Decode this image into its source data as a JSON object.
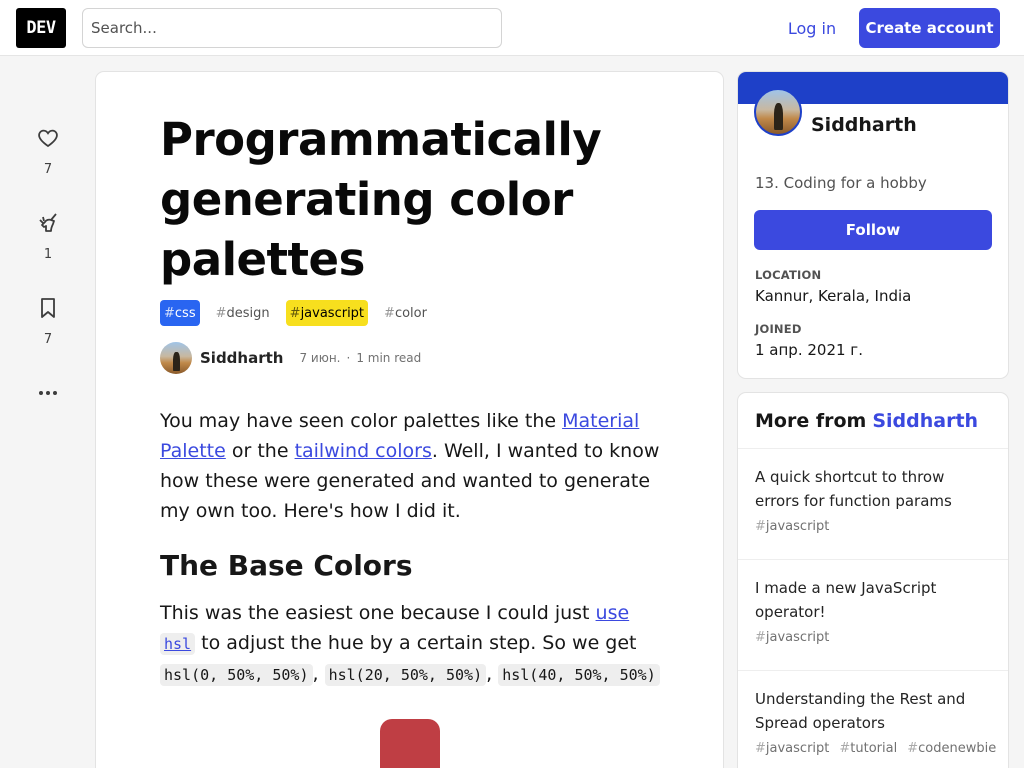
{
  "header": {
    "logo": "DEV",
    "search_placeholder": "Search...",
    "login_label": "Log in",
    "create_label": "Create account"
  },
  "reactions": {
    "likes": "7",
    "unicorns": "1",
    "bookmarks": "7"
  },
  "article": {
    "title": "Programmatically generating color palettes",
    "tags": [
      "css",
      "design",
      "javascript",
      "color"
    ],
    "author": "Siddharth",
    "date": "7 июн.",
    "read_time": "1 min read",
    "p1_a": "You may have seen color palettes like the ",
    "link_material": "Material Palette",
    "p1_b": " or the ",
    "link_tailwind": "tailwind colors",
    "p1_c": ". Well, I wanted to know how these were generated and wanted to generate my own too. Here's how I did it.",
    "h2": "The Base Colors",
    "p2_a": "This was the easiest one because I could just ",
    "link_use": "use",
    "code_hsl": "hsl",
    "p2_b": " to adjust the hue by a certain step. So we get ",
    "code_1": "hsl(0, 50%, 50%)",
    "sep_1": ", ",
    "code_2": "hsl(20, 50%, 50%)",
    "sep_2": ", ",
    "code_3": "hsl(40, 50%, 50%)",
    "swatch_color": "#bf3e44"
  },
  "profile": {
    "name": "Siddharth",
    "bio": "13. Coding for a hobby",
    "follow_label": "Follow",
    "location_label": "LOCATION",
    "location": "Kannur, Kerala, India",
    "joined_label": "JOINED",
    "joined": "1 апр. 2021 г."
  },
  "more": {
    "heading": "More from",
    "author": "Siddharth",
    "posts": [
      {
        "title": "A quick shortcut to throw errors for function params",
        "tags": [
          "javascript"
        ]
      },
      {
        "title": "I made a new JavaScript operator!",
        "tags": [
          "javascript"
        ]
      },
      {
        "title": "Understanding the Rest and Spread operators",
        "tags": [
          "javascript",
          "tutorial",
          "codenewbie"
        ]
      }
    ]
  },
  "colors": {
    "accent": "#3b49df",
    "css_tag": "#2965f1",
    "js_tag": "#f7df1e",
    "profile_band": "#1e40c8"
  }
}
